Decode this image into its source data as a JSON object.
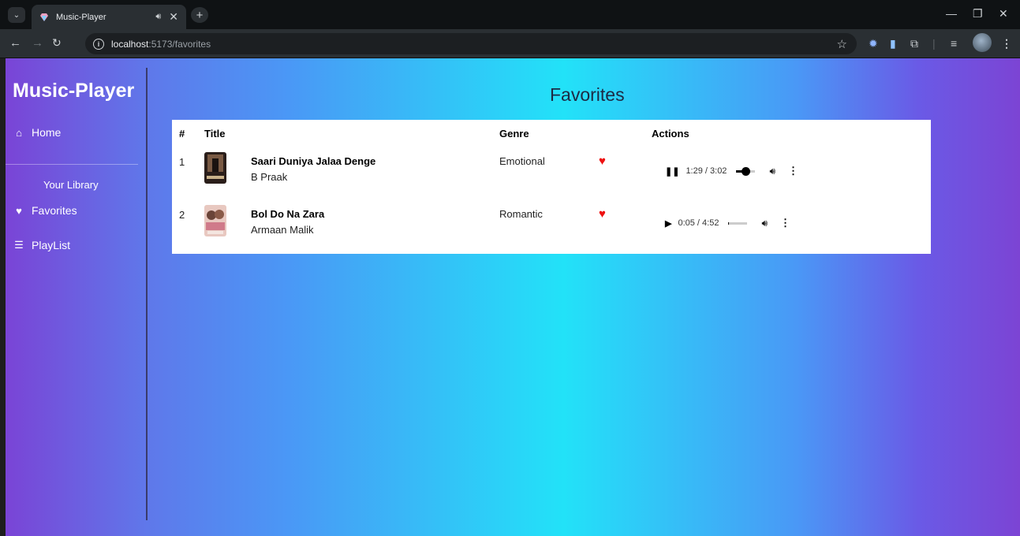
{
  "browser": {
    "tab_title": "Music-Player",
    "url_host": "localhost",
    "url_path": ":5173/favorites"
  },
  "sidebar": {
    "brand": "Music-Player",
    "home": "Home",
    "library_label": "Your Library",
    "favorites": "Favorites",
    "playlist": "PlayList"
  },
  "main": {
    "heading": "Favorites",
    "columns": {
      "num": "#",
      "title": "Title",
      "genre": "Genre",
      "actions": "Actions"
    },
    "rows": [
      {
        "num": "1",
        "title": "Saari Duniya Jalaa Denge",
        "artist": "B Praak",
        "genre": "Emotional",
        "favorited": true,
        "playing": true,
        "time": "1:29 / 3:02",
        "progress": 0.49
      },
      {
        "num": "2",
        "title": "Bol Do Na Zara",
        "artist": "Armaan Malik",
        "genre": "Romantic",
        "favorited": true,
        "playing": false,
        "time": "0:05 / 4:52",
        "progress": 0.02
      }
    ]
  },
  "colors": {
    "heart": "#ee1111",
    "heading": "#1d2a44"
  }
}
